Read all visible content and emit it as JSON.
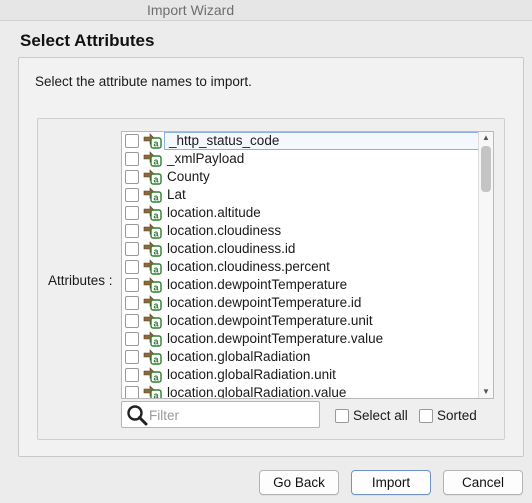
{
  "window": {
    "title": "Import Wizard"
  },
  "page": {
    "heading": "Select Attributes",
    "instruction": "Select the attribute names to import."
  },
  "attributes": {
    "label": "Attributes :",
    "items": [
      "_http_status_code",
      "_xmlPayload",
      "County",
      "Lat",
      "location.altitude",
      "location.cloudiness",
      "location.cloudiness.id",
      "location.cloudiness.percent",
      "location.dewpointTemperature",
      "location.dewpointTemperature.id",
      "location.dewpointTemperature.unit",
      "location.dewpointTemperature.value",
      "location.globalRadiation",
      "location.globalRadiation.unit",
      "location.globalRadiation.value"
    ],
    "filter_placeholder": "Filter",
    "select_all_label": "Select all",
    "sorted_label": "Sorted"
  },
  "buttons": {
    "go_back": "Go Back",
    "import": "Import",
    "cancel": "Cancel"
  },
  "colors": {
    "selection_border": "#8db2e2",
    "icon_arrow": "#8a6a3a",
    "icon_badge": "#2f7d32"
  }
}
